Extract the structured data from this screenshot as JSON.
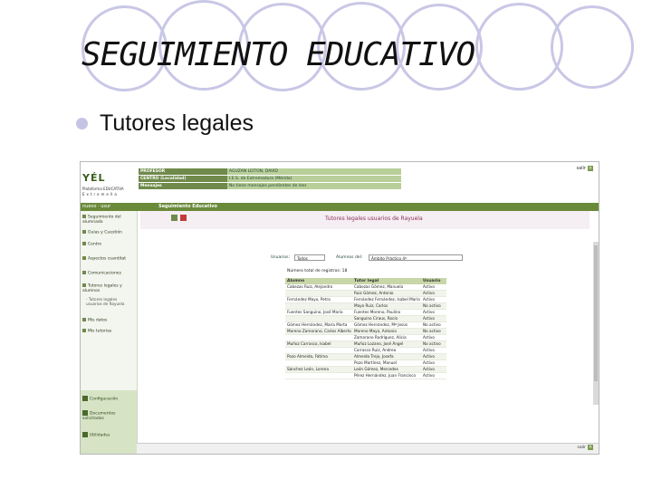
{
  "slide": {
    "title": "SEGUIMIENTO EDUCATIVO",
    "bullet": "Tutores legales"
  },
  "app": {
    "logo": {
      "main": "YÉL",
      "sub": "Plataforma EDUCATIVA",
      "sub2": "Extremeña"
    },
    "header": [
      {
        "key": "PROFESOR",
        "value": "AGUZAN LEITON, DAVID"
      },
      {
        "key": "CENTRO (Localidad)",
        "value": "I.E.S. de Extremadura (Mérida)"
      },
      {
        "key": "Mensajes",
        "value": "No tiene mensajes pendientes de leer"
      }
    ],
    "exit_label": "salir",
    "bar_left": "nuevo  ·  usur",
    "bar_center": "Seguimiento Educativo",
    "sidebar": [
      "Seguimiento del alumnado",
      "Guías y Cuestión",
      "Centro",
      "Aspectos cuantitat",
      "Comunicaciones",
      "Tutores legales y alumnos"
    ],
    "sidebar_sub": "- Tutores legales usuarios de Rayuela",
    "sidebar_more": [
      "Mis datos",
      "Mis tutorías"
    ],
    "sidebar_bottom": [
      "Configuración",
      "Documentos solicitados",
      "Utilidades"
    ],
    "content_title": "Tutores legales usuarios de Rayuela",
    "filter": {
      "usuarios_label": "Usuarios:",
      "usuarios_value": "Todos",
      "alumnos_label": "Alumnos del:",
      "alumnos_value": "Ámbito Práctico 4º"
    },
    "total_label": "Número total de registros: 18",
    "columns": [
      "Alumno",
      "Tutor legal",
      "Usuario"
    ],
    "rows": [
      [
        "Cabezas Ruiz, Alejandro",
        "Cabezas Gómez, Manuela",
        "Activo"
      ],
      [
        "",
        "Ruiz Gómez, Antonio",
        "Activo"
      ],
      [
        "Fernández Mayo, Petra",
        "Fernández Fernández, Isabel María",
        "Activo"
      ],
      [
        "",
        "Mayo Ruiz, Carlos",
        "No activo"
      ],
      [
        "Fuentes Sanguino, José María",
        "Fuentes Moreno, Paulino",
        "Activo"
      ],
      [
        "",
        "Sanguino Ciraus, Rocío",
        "Activo"
      ],
      [
        "Gómez Hernández, María Marta",
        "Gómez Hernández, Mª Jesús",
        "No activo"
      ],
      [
        "Moreno Zamorano, Carlos Alberto",
        "Moreno Mayo, Antonio",
        "No activo"
      ],
      [
        "",
        "Zamorano Rodríguez, Alicia",
        "Activo"
      ],
      [
        "Muñoz Carrasco, Isabel",
        "Muñoz Lozano, José Ángel",
        "No activo"
      ],
      [
        "",
        "Carrasco Ruiz, Andrea",
        "Activo"
      ],
      [
        "Pozo Almeida, Fátima",
        "Almeida Trejo, Josefa",
        "Activo"
      ],
      [
        "",
        "Pozo Martínez, Manuel",
        "Activo"
      ],
      [
        "Sánchez León, Lorena",
        "León Gómez, Mercedes",
        "Activo"
      ],
      [
        "",
        "Pérez Hernández, Juan Francisco",
        "Activo"
      ]
    ],
    "bottom_right": "salir"
  },
  "colors": {
    "circle": "#c9c7e6",
    "bar_green": "#6a8a3a",
    "title_purple": "#8a2f5a"
  }
}
